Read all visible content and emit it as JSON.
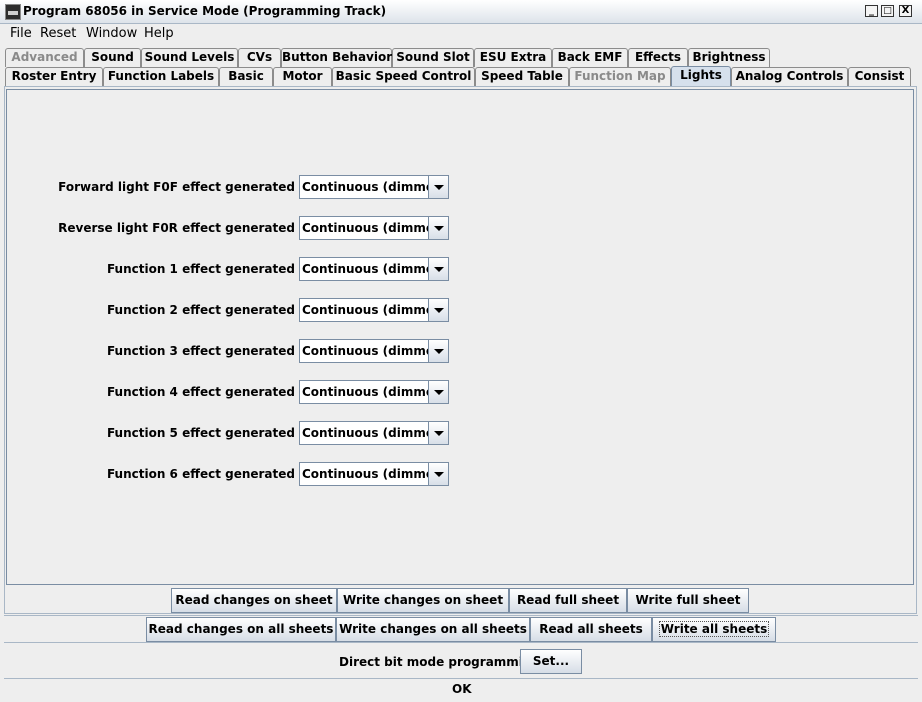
{
  "window": {
    "title": "Program 68056 in Service Mode (Programming Track)",
    "controls": {
      "minimize": "_",
      "maximize": "□",
      "close": "X"
    }
  },
  "menu": [
    "File",
    "Reset",
    "Window",
    "Help"
  ],
  "tabs_row1": [
    {
      "label": "Advanced",
      "disabled": true
    },
    {
      "label": "Sound"
    },
    {
      "label": "Sound Levels"
    },
    {
      "label": "CVs"
    },
    {
      "label": "Button Behavior"
    },
    {
      "label": "Sound Slot"
    },
    {
      "label": "ESU Extra"
    },
    {
      "label": "Back EMF"
    },
    {
      "label": "Effects"
    },
    {
      "label": "Brightness"
    }
  ],
  "tabs_row2": [
    {
      "label": "Roster Entry"
    },
    {
      "label": "Function Labels"
    },
    {
      "label": "Basic"
    },
    {
      "label": "Motor"
    },
    {
      "label": "Basic Speed Control"
    },
    {
      "label": "Speed Table"
    },
    {
      "label": "Function Map",
      "disabled": true
    },
    {
      "label": "Lights",
      "selected": true
    },
    {
      "label": "Analog Controls"
    },
    {
      "label": "Consist"
    }
  ],
  "lights": {
    "rows": [
      {
        "label": "Forward light F0F effect generated",
        "value": "Continuous (dimmer)"
      },
      {
        "label": "Reverse light F0R effect generated",
        "value": "Continuous (dimmer)"
      },
      {
        "label": "Function 1 effect generated",
        "value": "Continuous (dimmer)"
      },
      {
        "label": "Function 2 effect generated",
        "value": "Continuous (dimmer)"
      },
      {
        "label": "Function 3 effect generated",
        "value": "Continuous (dimmer)"
      },
      {
        "label": "Function 4 effect generated",
        "value": "Continuous (dimmer)"
      },
      {
        "label": "Function 5 effect generated",
        "value": "Continuous (dimmer)"
      },
      {
        "label": "Function 6 effect generated",
        "value": "Continuous (dimmer)"
      }
    ]
  },
  "sheet_buttons": {
    "read_changes": "Read changes on sheet",
    "write_changes": "Write changes on sheet",
    "read_full": "Read full sheet",
    "write_full": "Write full sheet"
  },
  "all_buttons": {
    "read_changes_all": "Read changes on all sheets",
    "write_changes_all": "Write changes on all sheets",
    "read_all": "Read all sheets",
    "write_all": "Write all sheets"
  },
  "mode": {
    "label": "Direct bit mode programming",
    "set_button": "Set..."
  },
  "status": "OK"
}
